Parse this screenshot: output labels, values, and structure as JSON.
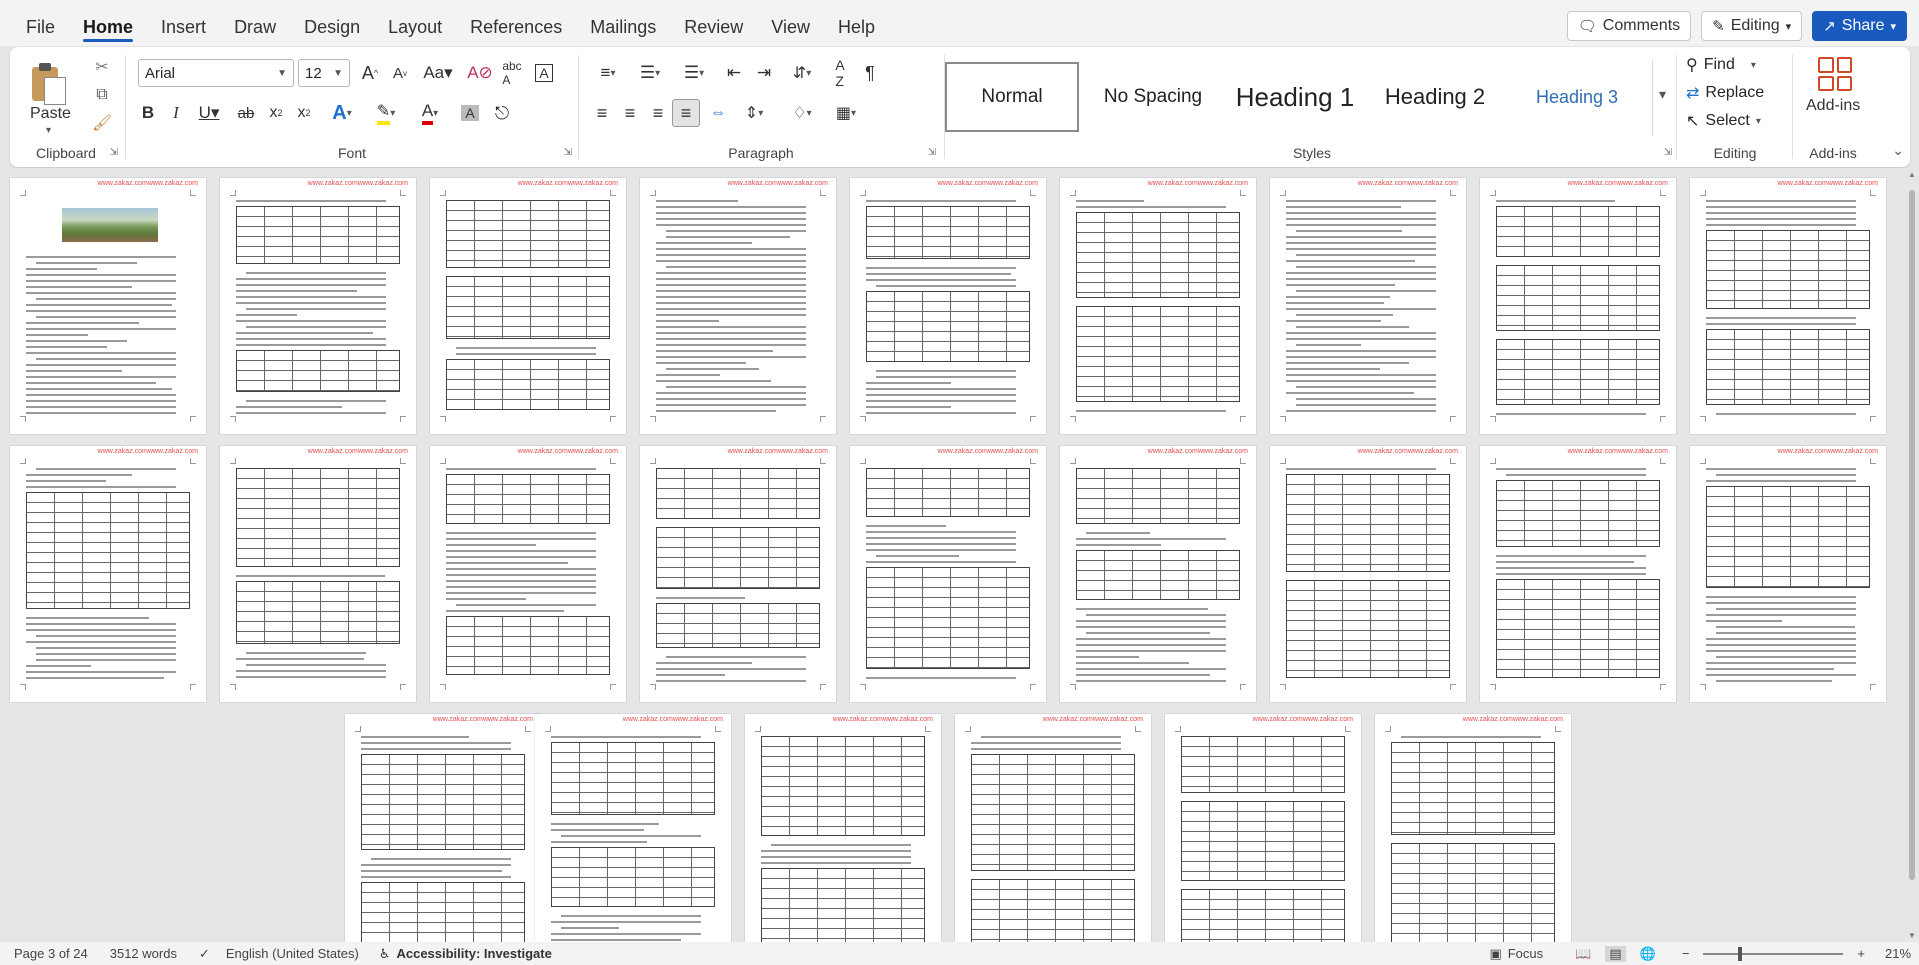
{
  "menu": {
    "tabs": [
      "File",
      "Home",
      "Insert",
      "Draw",
      "Design",
      "Layout",
      "References",
      "Mailings",
      "Review",
      "View",
      "Help"
    ],
    "active": "Home",
    "comments_label": "Comments",
    "editing_label": "Editing",
    "share_label": "Share"
  },
  "ribbon": {
    "groups": {
      "clipboard": "Clipboard",
      "font": "Font",
      "paragraph": "Paragraph",
      "styles": "Styles",
      "editing": "Editing",
      "addins": "Add-ins"
    },
    "paste_label": "Paste",
    "font_name": "Arial",
    "font_size": "12",
    "styles": [
      "Normal",
      "No Spacing",
      "Heading 1",
      "Heading 2",
      "Heading 3"
    ],
    "find_label": "Find",
    "replace_label": "Replace",
    "select_label": "Select",
    "addins_label": "Add-ins",
    "colors": {
      "accent": "#185abd",
      "highlight": "#ffe600",
      "font_color": "#e00000"
    }
  },
  "document": {
    "watermark": "www.zakaz.comwww.zakaz.com",
    "pages_shown": 25
  },
  "status": {
    "page": "Page 3 of 24",
    "words": "3512 words",
    "language": "English (United States)",
    "accessibility": "Accessibility: Investigate",
    "focus": "Focus",
    "zoom": "21%"
  }
}
